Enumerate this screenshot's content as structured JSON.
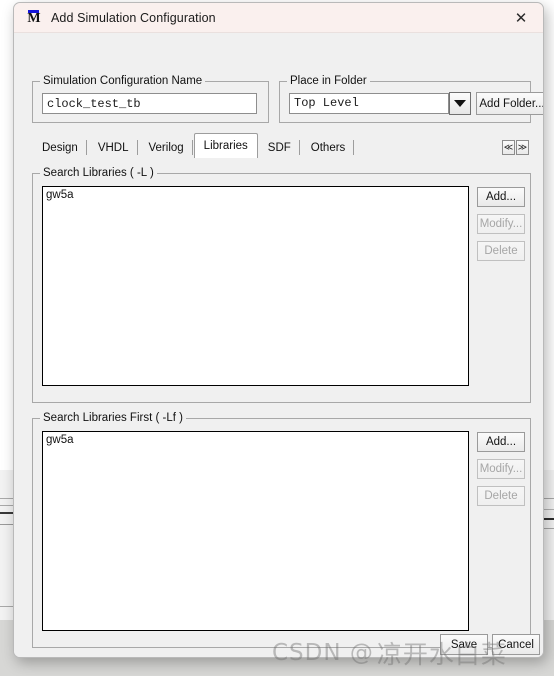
{
  "window": {
    "title": "Add Simulation Configuration",
    "app_icon": "modelsim-m-icon",
    "close_icon": "✕"
  },
  "name_group": {
    "legend": "Simulation Configuration Name",
    "value": "clock_test_tb",
    "placeholder": ""
  },
  "folder_group": {
    "legend": "Place in Folder",
    "selected": "Top Level",
    "options": [
      "Top Level"
    ],
    "dropdown_icon": "chevron-down-icon",
    "add_folder_label": "Add Folder..."
  },
  "tabs": {
    "items": [
      {
        "label": "Design",
        "selected": false
      },
      {
        "label": "VHDL",
        "selected": false
      },
      {
        "label": "Verilog",
        "selected": false
      },
      {
        "label": "Libraries",
        "selected": true
      },
      {
        "label": "SDF",
        "selected": false
      },
      {
        "label": "Others",
        "selected": false
      }
    ],
    "scroll_left_icon": "≪",
    "scroll_right_icon": "≫"
  },
  "search_libraries": {
    "legend": "Search Libraries ( -L )",
    "items": [
      "gw5a"
    ],
    "buttons": [
      {
        "label": "Add...",
        "enabled": true
      },
      {
        "label": "Modify...",
        "enabled": false
      },
      {
        "label": "Delete",
        "enabled": false
      }
    ]
  },
  "search_libraries_first": {
    "legend": "Search Libraries First ( -Lf )",
    "items": [
      "gw5a"
    ],
    "buttons": [
      {
        "label": "Add...",
        "enabled": true
      },
      {
        "label": "Modify...",
        "enabled": false
      },
      {
        "label": "Delete",
        "enabled": false
      }
    ]
  },
  "footer": {
    "save_label": "Save",
    "cancel_label": "Cancel"
  },
  "watermark": {
    "prefix": "CSDN @",
    "handle": "凉开水白菜"
  },
  "colors": {
    "titlebar": "#faf0ee",
    "dialog_face": "#f0f0f0",
    "field_bg": "#ffffff",
    "accent_blue": "#1414d8",
    "disabled_text": "#a6a6a6"
  }
}
